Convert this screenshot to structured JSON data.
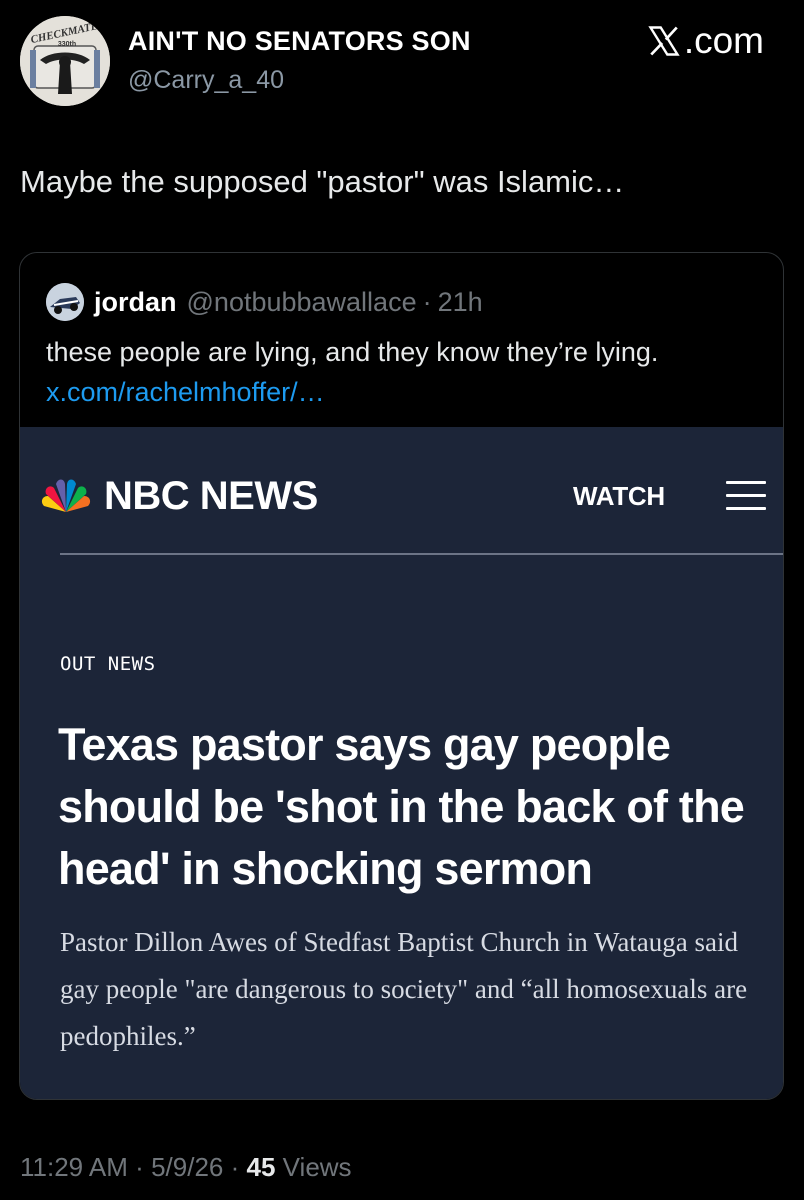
{
  "post": {
    "author_name": "AIN'T NO SENATORS SON",
    "author_handle": "@Carry_a_40",
    "avatar_text": "CHECKMATE",
    "avatar_subtext": "330th",
    "brand": ".com",
    "text": "Maybe the supposed \"pastor\" was Islamic…",
    "time": "11:29 AM",
    "date": "5/9/26",
    "views_count": "45",
    "views_label": "Views",
    "separator": "·"
  },
  "quote": {
    "name": "jordan",
    "handle": "@notbubbawallace",
    "time": "21h",
    "separator": "·",
    "text": "these people are lying, and they know they’re lying.",
    "link": "x.com/rachelmhoffer/…"
  },
  "article": {
    "outlet": "NBC NEWS",
    "watch_label": "WATCH",
    "section": "OUT NEWS",
    "headline": "Texas pastor says gay people should be 'shot in the back of the head' in shocking sermon",
    "dek": "Pastor Dillon Awes of Stedfast Baptist Church in Watauga said gay people \"are dangerous to society\" and “all homosexuals are pedophiles.”"
  },
  "colors": {
    "background": "#000000",
    "article_background": "#1c2538",
    "link": "#1d9bf0",
    "muted": "#71767b"
  },
  "icons": {
    "brand": "x-logo-icon",
    "outlet": "nbc-peacock-icon",
    "menu": "hamburger-menu-icon"
  }
}
